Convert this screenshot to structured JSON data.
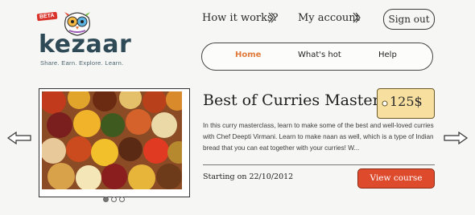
{
  "logo": {
    "name": "kezaar",
    "tagline": "Share. Earn. Explore. Learn.",
    "beta": "BETA"
  },
  "topnav": {
    "how_it_works": "How it works?",
    "my_account": "My account",
    "sign_out": "Sign out"
  },
  "tabs": [
    {
      "label": "Home",
      "active": true
    },
    {
      "label": "What's hot",
      "active": false
    },
    {
      "label": "Help",
      "active": false
    }
  ],
  "course": {
    "title": "Best of Curries Master...",
    "price": "125$",
    "description": "In this curry masterclass, learn to make some of the best and well-loved curries with Chef Deepti Virmani. Learn to make naan as well, which is a type of Indian bread that you can eat together with your curries! W...",
    "start": "Starting on 22/10/2012",
    "cta": "View course"
  },
  "carousel": {
    "dots": 3,
    "active_dot": 0
  },
  "colors": {
    "accent": "#e07a3a",
    "cta": "#dd4a2c",
    "price_tag": "#f6df9f",
    "logo": "#2f4a57"
  }
}
